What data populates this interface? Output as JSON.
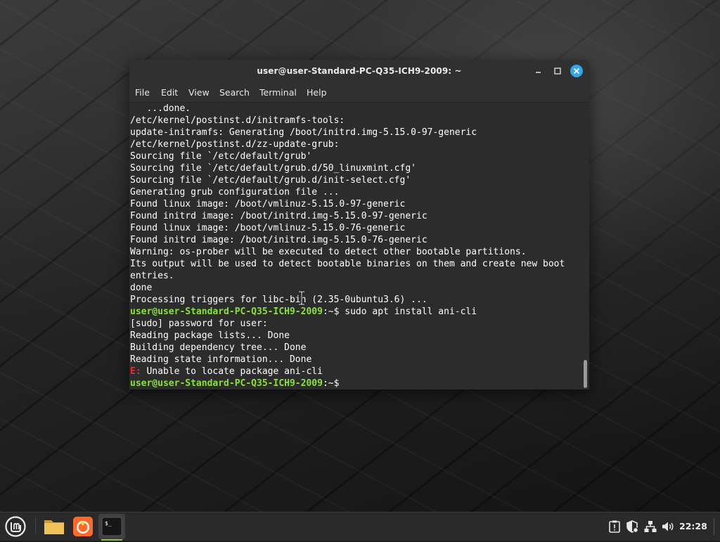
{
  "window": {
    "title": "user@user-Standard-PC-Q35-ICH9-2009: ~"
  },
  "menubar": {
    "items": [
      "File",
      "Edit",
      "View",
      "Search",
      "Terminal",
      "Help"
    ]
  },
  "terminal": {
    "lines": [
      "   ...done.",
      "/etc/kernel/postinst.d/initramfs-tools:",
      "update-initramfs: Generating /boot/initrd.img-5.15.0-97-generic",
      "/etc/kernel/postinst.d/zz-update-grub:",
      "Sourcing file `/etc/default/grub'",
      "Sourcing file `/etc/default/grub.d/50_linuxmint.cfg'",
      "Sourcing file `/etc/default/grub.d/init-select.cfg'",
      "Generating grub configuration file ...",
      "Found linux image: /boot/vmlinuz-5.15.0-97-generic",
      "Found initrd image: /boot/initrd.img-5.15.0-97-generic",
      "Found linux image: /boot/vmlinuz-5.15.0-76-generic",
      "Found initrd image: /boot/initrd.img-5.15.0-76-generic",
      "Warning: os-prober will be executed to detect other bootable partitions.",
      "Its output will be used to detect bootable binaries on them and create new boot",
      "entries.",
      "done",
      "Processing triggers for libc-bin (2.35-0ubuntu3.6) ..."
    ],
    "prompt_user": "user@user-Standard-PC-Q35-ICH9-2009",
    "prompt_path": ":~$",
    "command": " sudo apt install ani-cli",
    "after_lines": [
      "[sudo] password for user:",
      "Reading package lists... Done",
      "Building dependency tree... Done",
      "Reading state information... Done"
    ],
    "error_prefix": "E:",
    "error_message": " Unable to locate package ani-cli",
    "final_prompt_user": "user@user-Standard-PC-Q35-ICH9-2009",
    "final_prompt_path": ":~$"
  },
  "panel": {
    "clock": "22:28",
    "launchers": [
      "mint-menu-icon",
      "files-folder-icon",
      "firefox-icon",
      "terminal-icon"
    ],
    "tray": [
      "update-manager-icon",
      "shield-icon",
      "network-icon",
      "volume-icon"
    ]
  },
  "colors": {
    "prompt": "#8ae234",
    "error": "#ef2929",
    "close_button": "#35a5ea"
  }
}
